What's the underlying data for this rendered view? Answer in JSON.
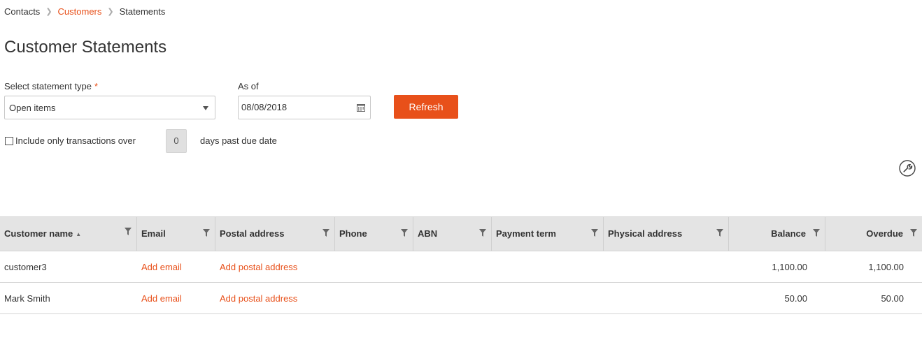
{
  "breadcrumb": {
    "items": [
      "Contacts",
      "Customers",
      "Statements"
    ]
  },
  "page": {
    "title": "Customer Statements"
  },
  "form": {
    "statement_type": {
      "label": "Select statement type",
      "required_mark": "*",
      "value": "Open items"
    },
    "as_of": {
      "label": "As of",
      "value": "08/08/2018"
    },
    "refresh_label": "Refresh",
    "include_only": {
      "label": "Include only transactions over",
      "checked": false,
      "days": "0",
      "suffix": "days past due date"
    }
  },
  "table": {
    "columns": [
      "Customer name",
      "Email",
      "Postal address",
      "Phone",
      "ABN",
      "Payment term",
      "Physical address",
      "Balance",
      "Overdue"
    ],
    "sorted_column": "Customer name",
    "sort_direction": "ascending",
    "rows": [
      {
        "customer_name": "customer3",
        "email": "Add email",
        "postal_address": "Add postal address",
        "phone": "",
        "abn": "",
        "payment_term": "",
        "physical_address": "",
        "balance": "1,100.00",
        "overdue": "1,100.00"
      },
      {
        "customer_name": "Mark Smith",
        "email": "Add email",
        "postal_address": "Add postal address",
        "phone": "",
        "abn": "",
        "payment_term": "",
        "physical_address": "",
        "balance": "50.00",
        "overdue": "50.00"
      }
    ]
  },
  "icons": {
    "calendar": "calendar-icon",
    "settings": "wrench-icon",
    "filter": "filter-icon",
    "sort": "sort-ascending-icon"
  },
  "colors": {
    "accent": "#e8501a",
    "header_bg": "#e4e4e4"
  }
}
